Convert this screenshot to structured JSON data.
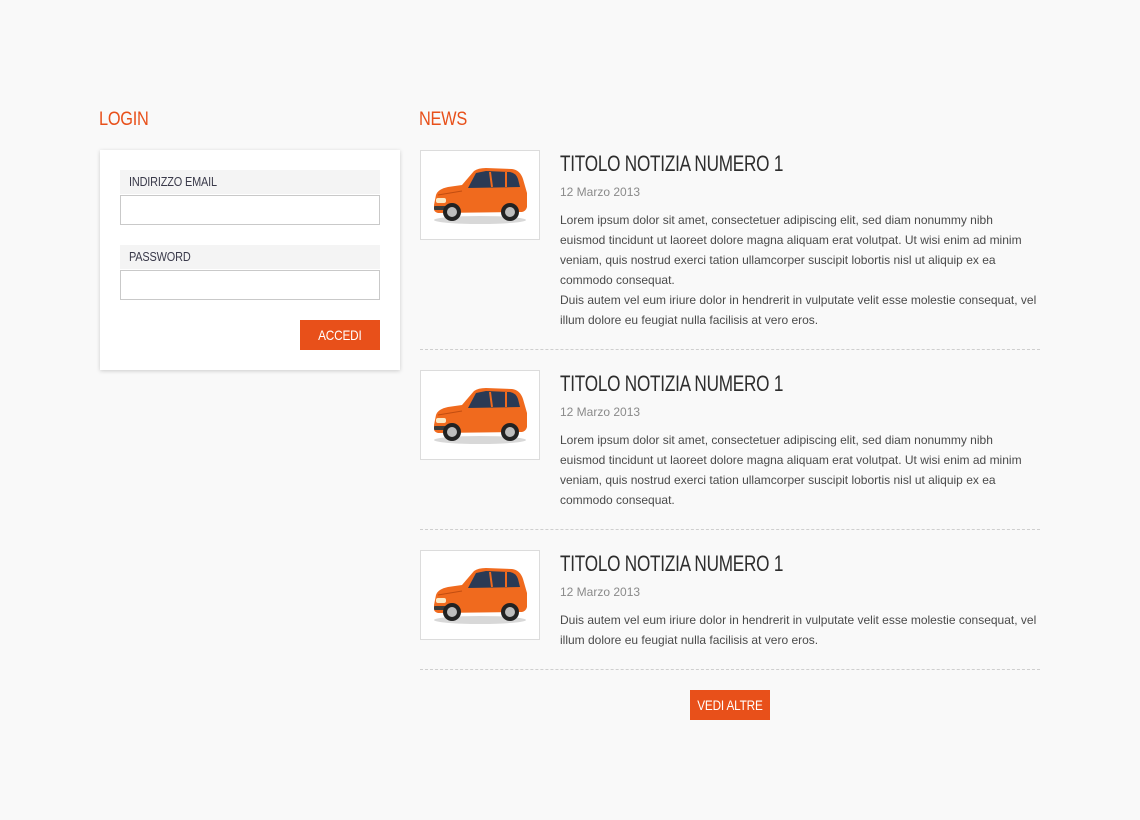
{
  "login": {
    "title": "LOGIN",
    "email_label": "INDIRIZZO EMAIL",
    "email_value": "",
    "password_label": "PASSWORD",
    "password_value": "",
    "submit_label": "ACCEDI"
  },
  "news": {
    "title": "NEWS",
    "items": [
      {
        "headline": "TITOLO NOTIZIA NUMERO 1",
        "date": "12 Marzo 2013",
        "paragraphs": [
          "Lorem ipsum dolor sit amet, consectetuer adipiscing elit, sed diam nonummy nibh euismod tincidunt ut laoreet dolore magna aliquam erat volutpat. Ut wisi enim ad minim veniam, quis nostrud exerci tation ullamcorper suscipit lobortis nisl ut aliquip ex ea commodo consequat.",
          "Duis autem vel eum iriure dolor in hendrerit in vulputate velit esse molestie consequat, vel illum dolore eu feugiat nulla facilisis at vero eros."
        ]
      },
      {
        "headline": "TITOLO NOTIZIA NUMERO 1",
        "date": "12 Marzo 2013",
        "paragraphs": [
          "Lorem ipsum dolor sit amet, consectetuer adipiscing elit, sed diam nonummy nibh euismod tincidunt ut laoreet dolore magna aliquam erat volutpat. Ut wisi enim ad minim veniam, quis nostrud exerci tation ullamcorper suscipit lobortis nisl ut aliquip ex ea commodo consequat."
        ]
      },
      {
        "headline": "TITOLO NOTIZIA NUMERO 1",
        "date": "12 Marzo 2013",
        "paragraphs": [
          "Duis autem vel eum iriure dolor in hendrerit in vulputate velit esse molestie consequat, vel illum dolore eu feugiat nulla facilisis at vero eros."
        ]
      }
    ],
    "more_label": "VEDI ALTRE"
  },
  "colors": {
    "accent": "#e8501a",
    "background": "#f9f9f9",
    "car_body": "#f06a1e"
  },
  "icons": {
    "news_thumbnail": "car-image"
  }
}
